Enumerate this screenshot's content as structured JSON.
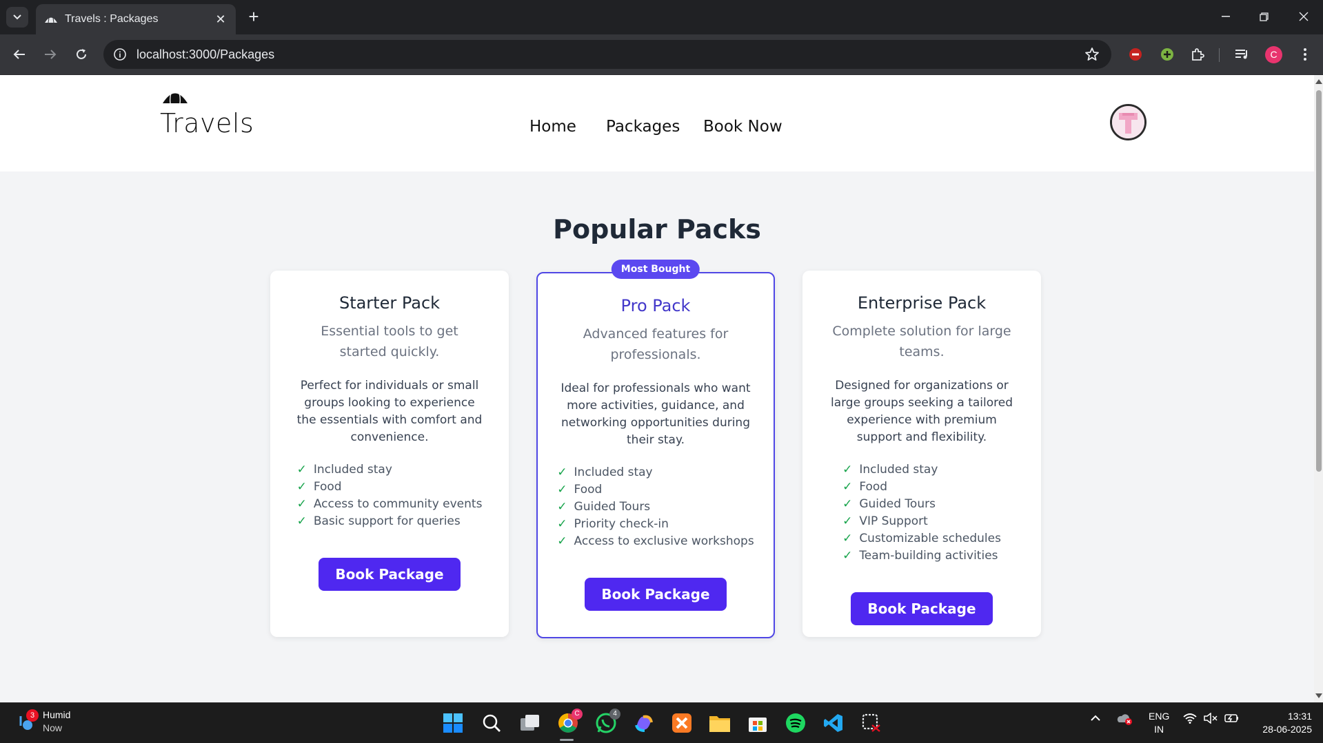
{
  "browser": {
    "tab_title": "Travels : Packages",
    "url": "localhost:3000/Packages",
    "profile_initial": "C"
  },
  "site": {
    "logo_text": "Travels",
    "nav": [
      "Home",
      "Packages",
      "Book Now"
    ]
  },
  "main": {
    "title": "Popular Packs",
    "cards": [
      {
        "title": "Starter Pack",
        "subtitle": "Essential tools to get started quickly.",
        "description": "Perfect for individuals or small groups looking to experience the essentials with comfort and convenience.",
        "features": [
          "Included stay",
          "Food",
          "Access to community events",
          "Basic support for queries"
        ],
        "button": "Book Package"
      },
      {
        "badge": "Most Bought",
        "title": "Pro Pack",
        "subtitle": "Advanced features for professionals.",
        "description": "Ideal for professionals who want more activities, guidance, and networking opportunities during their stay.",
        "features": [
          "Included stay",
          "Food",
          "Guided Tours",
          "Priority check-in",
          "Access to exclusive workshops"
        ],
        "button": "Book Package"
      },
      {
        "title": "Enterprise Pack",
        "subtitle": "Complete solution for large teams.",
        "description": "Designed for organizations or large groups seeking a tailored experience with premium support and flexibility.",
        "features": [
          "Included stay",
          "Food",
          "Guided Tours",
          "VIP Support",
          "Customizable schedules",
          "Team-building activities"
        ],
        "button": "Book Package"
      }
    ],
    "check_glyph": "✓"
  },
  "taskbar": {
    "weather_title": "Humid",
    "weather_sub": "Now",
    "weather_badge": "3",
    "whatsapp_badge": "4",
    "chrome_badge": "C",
    "lang_top": "ENG",
    "lang_bottom": "IN",
    "time": "13:31",
    "date": "28-06-2025"
  },
  "colors": {
    "accent": "#4f28f0",
    "badge": "#5b48f0",
    "check": "#16a34a",
    "page_bg": "#f3f4f6"
  }
}
